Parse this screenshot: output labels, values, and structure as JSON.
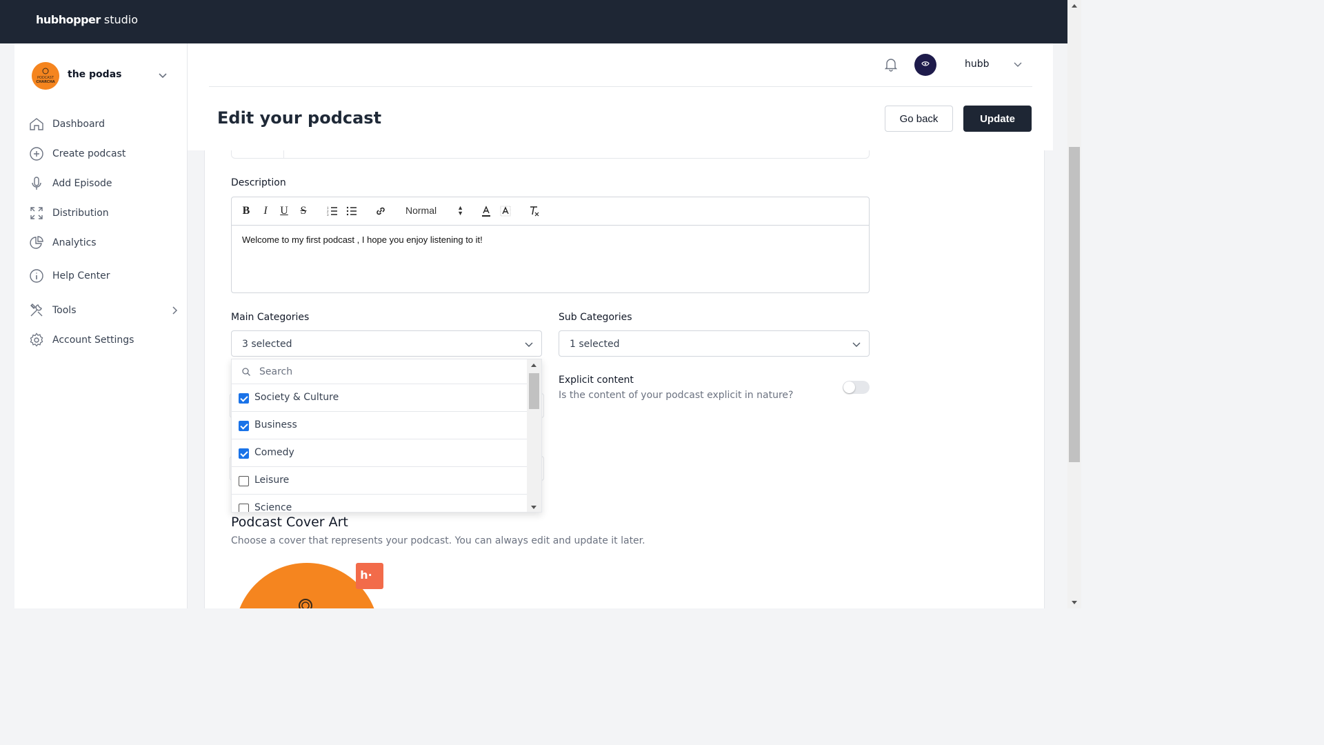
{
  "brand": {
    "bold": "hubhopper",
    "rest": " studio"
  },
  "sidebar": {
    "podcast_name": "the podas",
    "podcast_logo_text": "PODCAST CHARCHA",
    "items": [
      {
        "label": "Dashboard",
        "icon": "home-icon"
      },
      {
        "label": "Create podcast",
        "icon": "plus-circle-icon"
      },
      {
        "label": "Add Episode",
        "icon": "microphone-icon"
      },
      {
        "label": "Distribution",
        "icon": "expand-icon"
      },
      {
        "label": "Analytics",
        "icon": "pie-chart-icon"
      },
      {
        "label": "Help Center",
        "icon": "info-icon"
      },
      {
        "label": "Tools",
        "icon": "tools-icon"
      },
      {
        "label": "Account Settings",
        "icon": "gear-icon"
      }
    ]
  },
  "header": {
    "username": "hubb",
    "title": "Edit your podcast",
    "go_back_label": "Go back",
    "update_label": "Update"
  },
  "form": {
    "description_label": "Description",
    "editor_size": "Normal",
    "description_text": "Welcome to my first podcast , I hope you enjoy listening to it!",
    "main_categories_label": "Main Categories",
    "main_categories_value": "3 selected",
    "sub_categories_label": "Sub Categories",
    "sub_categories_value": "1 selected",
    "search_placeholder": "Search",
    "categories": [
      {
        "name": "Society & Culture",
        "checked": true
      },
      {
        "name": "Business",
        "checked": true
      },
      {
        "name": "Comedy",
        "checked": true
      },
      {
        "name": "Leisure",
        "checked": false
      },
      {
        "name": "Science",
        "checked": false
      }
    ],
    "explicit_title": "Explicit content",
    "explicit_desc": "Is the content of your podcast explicit in nature?",
    "cover_title": "Podcast Cover Art",
    "cover_desc": "Choose a cover that represents your podcast. You can always edit and update it later."
  },
  "colors": {
    "topbar": "#1e2634",
    "accent_orange": "#f5851f",
    "checkbox_blue": "#1a73e8"
  }
}
